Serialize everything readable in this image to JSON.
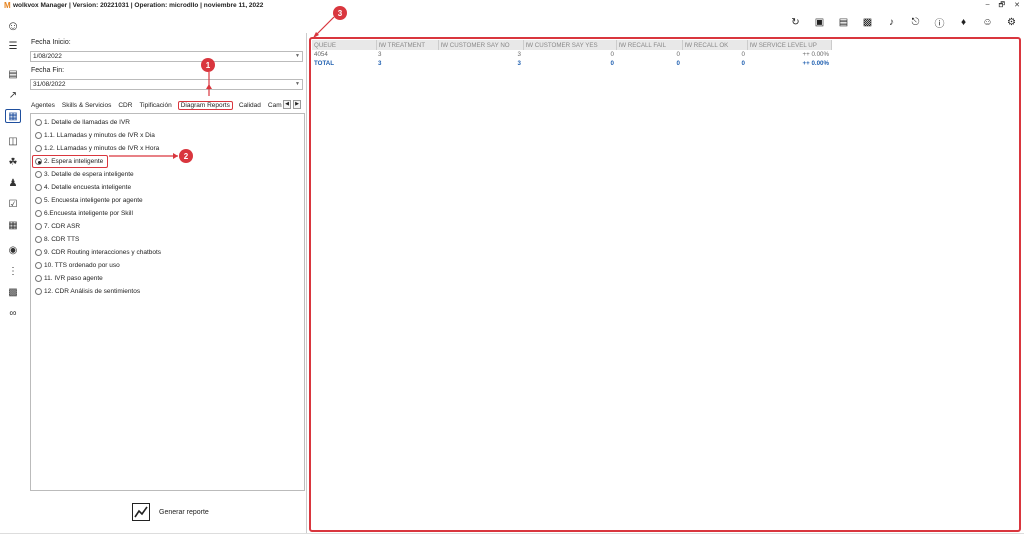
{
  "app": {
    "logo": "M",
    "title": "wolkvox Manager  | Version: 20221031 |  Operation: microdllo | noviembre 11, 2022"
  },
  "window": {
    "minimize": "–",
    "restore": "🗗",
    "close": "✕"
  },
  "sidebar": {
    "icons": [
      "user-circle-icon",
      "menu-icon",
      "bar-chart-icon",
      "trend-icon",
      "report-icon",
      "flow-icon",
      "campaign-icon",
      "users-icon",
      "checklist-icon",
      "calculator-icon",
      "shield-icon",
      "audio-wave-icon",
      "video-add-icon",
      "voicemail-icon"
    ]
  },
  "toolbar": {
    "icons": [
      "refresh-icon",
      "toolbox-icon",
      "library-icon",
      "contact-card-icon",
      "music-note-icon",
      "microphone-icon",
      "help-icon",
      "bell-icon",
      "account-icon",
      "settings-icon"
    ]
  },
  "form": {
    "start_label": "Fecha Inicio:",
    "start_value": "1/08/2022",
    "end_label": "Fecha Fin:",
    "end_value": "31/08/2022"
  },
  "tabs": [
    "Agentes",
    "Skills & Servicios",
    "CDR",
    "Tipificación",
    "Diagram Reports",
    "Calidad",
    "Cam"
  ],
  "active_tab": "Diagram Reports",
  "tab_nav": {
    "prev": "◀",
    "next": "▶"
  },
  "reports": [
    "1. Detalle de llamadas de IVR",
    "1.1. LLamadas y minutos de IVR x Dia",
    "1.2. LLamadas y minutos de IVR x Hora",
    "2. Espera inteligente",
    "3. Detalle de espera inteligente",
    "4. Detalle encuesta inteligente",
    "5. Encuesta inteligente por agente",
    "6.Encuesta inteligente por Skill",
    "7. CDR ASR",
    "8. CDR TTS",
    "9. CDR Routing interacciones y chatbots",
    "10. TTS ordenado por uso",
    "11. IVR paso agente",
    "12. CDR Análisis de sentimientos"
  ],
  "selected_report": "2. Espera inteligente",
  "generate_label": "Generar reporte",
  "table": {
    "columns": [
      "QUEUE",
      "IW TREATMENT",
      "IW CUSTOMER SAY NO",
      "IW CUSTOMER SAY YES",
      "IW RECALL FAIL",
      "IW RECALL OK",
      "IW SERVICE LEVEL UP"
    ],
    "rows": [
      [
        "4054",
        "3",
        "3",
        "0",
        "0",
        "0",
        "++ 0.00%"
      ]
    ],
    "total": [
      "TOTAL",
      "3",
      "3",
      "0",
      "0",
      "0",
      "++ 0.00%"
    ]
  },
  "markers": [
    "1",
    "2",
    "3"
  ],
  "colors": {
    "accent_red": "#d9363e",
    "total_blue": "#1f5fb0",
    "logo_orange": "#e5831f"
  }
}
